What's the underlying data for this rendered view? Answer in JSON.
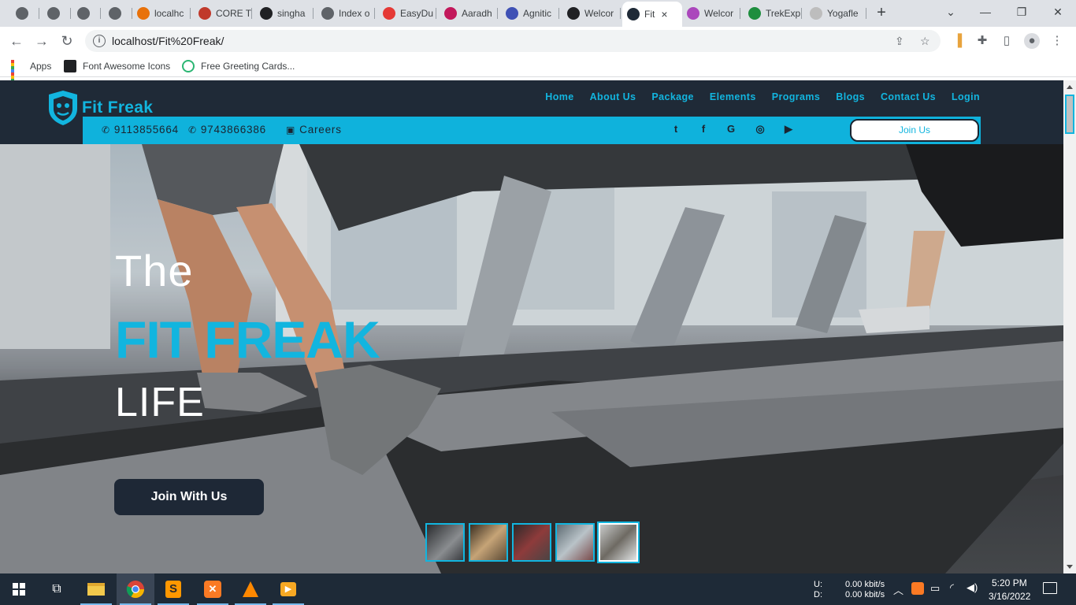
{
  "browser": {
    "tabs": [
      {
        "title": "",
        "color": "#5f6368"
      },
      {
        "title": "",
        "color": "#5f6368"
      },
      {
        "title": "",
        "color": "#5f6368"
      },
      {
        "title": "",
        "color": "#5f6368"
      },
      {
        "title": "localhc",
        "color": "#e8710a"
      },
      {
        "title": "CORE T",
        "color": "#c0392b"
      },
      {
        "title": "singha",
        "color": "#202124"
      },
      {
        "title": "Index o",
        "color": "#5f6368"
      },
      {
        "title": "EasyDu",
        "color": "#e53935"
      },
      {
        "title": "Aaradh",
        "color": "#c2185b"
      },
      {
        "title": "Agnitic",
        "color": "#3f51b5"
      },
      {
        "title": "Welcor",
        "color": "#202124"
      },
      {
        "title": "Fit",
        "color": "#1f2a37"
      },
      {
        "title": "Welcor",
        "color": "#ab47bc"
      },
      {
        "title": "TrekExp",
        "color": "#1e8e3e"
      },
      {
        "title": "Yogafle",
        "color": "#bdbdbd"
      }
    ],
    "active_tab_close": "×",
    "new_tab": "+",
    "url": "localhost/Fit%20Freak/",
    "bookmarks": [
      {
        "label": "Apps"
      },
      {
        "label": "Font Awesome Icons"
      },
      {
        "label": "Free Greeting Cards..."
      }
    ]
  },
  "site": {
    "brand": "Fit Freak",
    "nav": [
      "Home",
      "About Us",
      "Package",
      "Elements",
      "Programs",
      "Blogs",
      "Contact Us",
      "Login"
    ],
    "phone1": "9113855664",
    "phone2": "9743866386",
    "careers": "Careers",
    "social_icons": [
      "twitter-icon",
      "facebook-icon",
      "google-icon",
      "whatsapp-icon",
      "youtube-icon"
    ],
    "join_us": "Join Us",
    "accent": "#12b5df",
    "header_bg": "#1f2a37"
  },
  "hero": {
    "line1": "The",
    "line2": "FIT FREAK",
    "line3": "LIFE",
    "cta": "Join With Us",
    "thumbnail_count": 5
  },
  "taskbar": {
    "net_up_label": "U:",
    "net_down_label": "D:",
    "net_up": "0.00 kbit/s",
    "net_down": "0.00 kbit/s",
    "time": "5:20 PM",
    "date": "3/16/2022"
  }
}
